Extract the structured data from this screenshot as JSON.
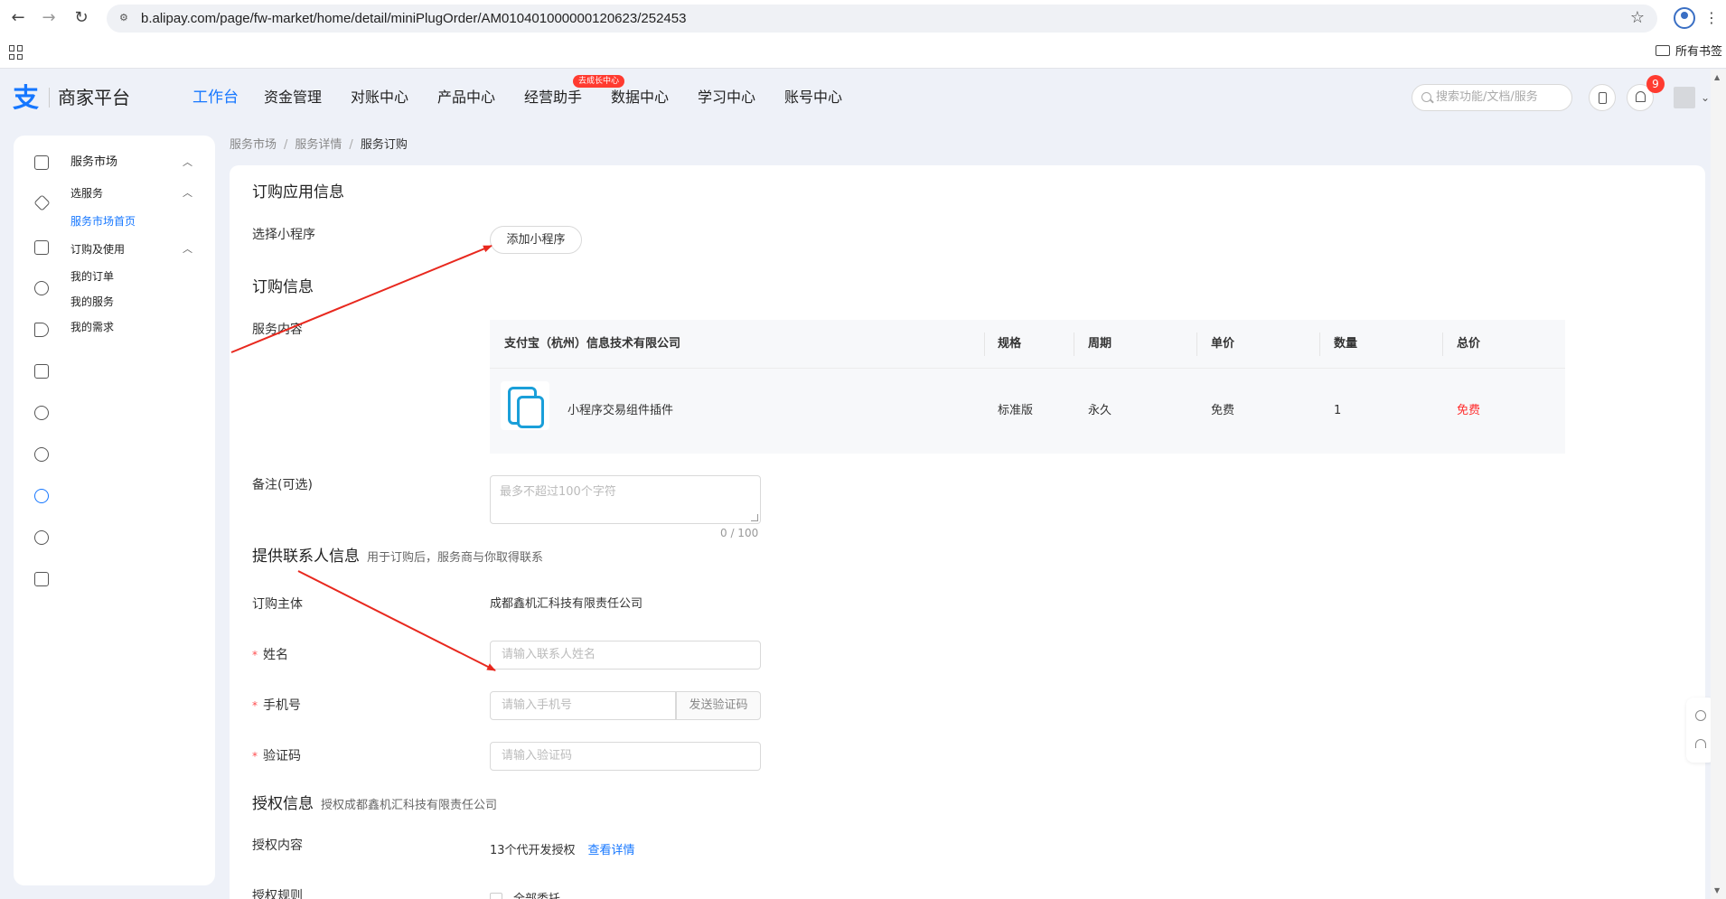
{
  "browser": {
    "url": "b.alipay.com/page/fw-market/home/detail/miniPlugOrder/AM010401000000120623/252453",
    "bookmarks_folder": "所有书签",
    "nav_icons": [
      "back-arrow-icon",
      "forward-arrow-icon",
      "reload-icon",
      "site-settings-icon",
      "bookmark-star-icon",
      "profile-icon",
      "menu-icon",
      "apps-icon",
      "folder-icon"
    ]
  },
  "header": {
    "brand": "商家平台",
    "nav": [
      "工作台",
      "资金管理",
      "对账中心",
      "产品中心",
      "经营助手",
      "数据中心",
      "学习中心",
      "账号中心"
    ],
    "active_nav": "工作台",
    "nav_badge": "去成长中心",
    "search_placeholder": "搜索功能/文档/服务",
    "notification_count": "9"
  },
  "sidebar": {
    "sections": [
      {
        "label": "服务市场",
        "icon": "store-icon",
        "expanded": true
      },
      {
        "label": "选服务",
        "icon": "cube-icon",
        "expanded": true
      },
      {
        "label": "服务市场首页",
        "active": true
      },
      {
        "label": "订购及使用",
        "icon": "document-icon",
        "expanded": true
      },
      {
        "label": "我的订单"
      },
      {
        "label": "我的服务"
      },
      {
        "label": "我的需求"
      }
    ],
    "collapsed_icons": [
      "bulb-icon",
      "megaphone-icon",
      "monitor-icon",
      "user-icon",
      "location-icon",
      "shield-check-icon",
      "target-icon",
      "window-icon"
    ],
    "accent_color": "#1677ff"
  },
  "breadcrumb": [
    "服务市场",
    "服务详情",
    "服务订购"
  ],
  "order_app": {
    "title": "订购应用信息",
    "select_label": "选择小程序",
    "add_button": "添加小程序"
  },
  "order_info": {
    "title": "订购信息",
    "content_label": "服务内容",
    "table": {
      "vendor": "支付宝（杭州）信息技术有限公司",
      "columns": [
        "规格",
        "周期",
        "单价",
        "数量",
        "总价"
      ],
      "row": {
        "product": "小程序交易组件插件",
        "spec": "标准版",
        "period": "永久",
        "unit_price": "免费",
        "quantity": "1",
        "total": "免费"
      }
    },
    "remark_label": "备注(可选)",
    "remark_placeholder": "最多不超过100个字符",
    "char_count": "0 / 100"
  },
  "contact": {
    "title": "提供联系人信息",
    "hint": "用于订购后，服务商与你取得联系",
    "subject_label": "订购主体",
    "subject_value": "成都鑫机汇科技有限责任公司",
    "name_label": "姓名",
    "name_placeholder": "请输入联系人姓名",
    "phone_label": "手机号",
    "phone_placeholder": "请输入手机号",
    "sms_button": "发送验证码",
    "code_label": "验证码",
    "code_placeholder": "请输入验证码",
    "required_mark": "*"
  },
  "auth": {
    "title": "授权信息",
    "hint": "授权成都鑫机汇科技有限责任公司",
    "content_label": "授权内容",
    "content_value": "13个代开发授权",
    "detail_link": "查看详情",
    "rules_label": "授权规则",
    "rules_option": "全部委托"
  },
  "annotation_color": "#e8281e"
}
